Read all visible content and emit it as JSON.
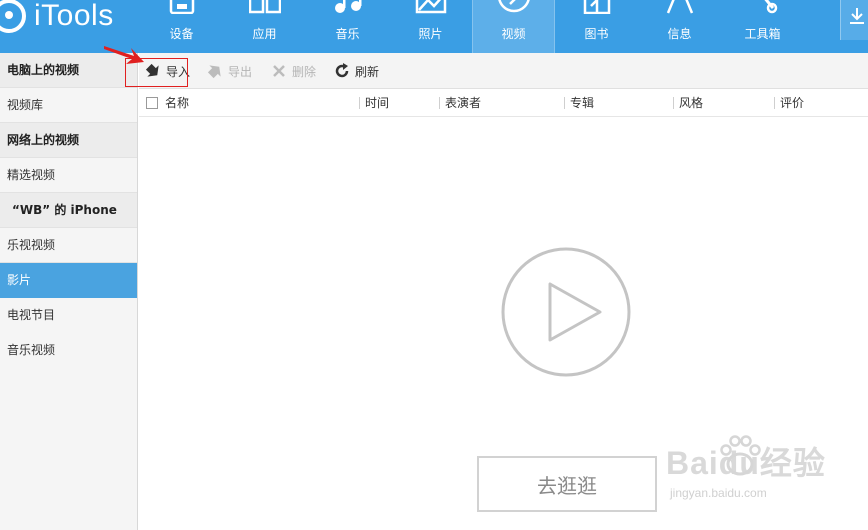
{
  "app": {
    "logo_text": "iTools"
  },
  "nav": {
    "items": [
      {
        "label": "设备",
        "icon": "device-icon"
      },
      {
        "label": "应用",
        "icon": "apps-icon"
      },
      {
        "label": "音乐",
        "icon": "music-icon"
      },
      {
        "label": "照片",
        "icon": "photo-icon"
      },
      {
        "label": "视频",
        "icon": "video-icon",
        "active": true
      },
      {
        "label": "图书",
        "icon": "book-icon"
      },
      {
        "label": "信息",
        "icon": "message-icon"
      },
      {
        "label": "工具箱",
        "icon": "toolbox-icon"
      }
    ]
  },
  "sidebar": {
    "items": [
      {
        "label": "电脑上的视频",
        "type": "header"
      },
      {
        "label": "视频库",
        "type": "item"
      },
      {
        "label": "网络上的视频",
        "type": "header"
      },
      {
        "label": "精选视频",
        "type": "item"
      },
      {
        "label": "“WB” 的 iPhone",
        "type": "header"
      },
      {
        "label": "乐视视频",
        "type": "item"
      },
      {
        "label": "影片",
        "type": "item",
        "selected": true
      },
      {
        "label": "电视节目",
        "type": "item"
      },
      {
        "label": "音乐视频",
        "type": "item"
      }
    ]
  },
  "toolbar": {
    "import_label": "导入",
    "export_label": "导出",
    "delete_label": "删除",
    "refresh_label": "刷新"
  },
  "table": {
    "columns": [
      "名称",
      "时间",
      "表演者",
      "专辑",
      "风格",
      "评价"
    ]
  },
  "empty_state": {
    "button_label": "去逛逛"
  },
  "watermark": {
    "main": "Bai",
    "main_tail": "du经验",
    "sub": "jingyan.baidu.com"
  },
  "colors": {
    "topbar": "#3a9ee4",
    "selected": "#4aa3e0",
    "highlight": "#e02020"
  }
}
